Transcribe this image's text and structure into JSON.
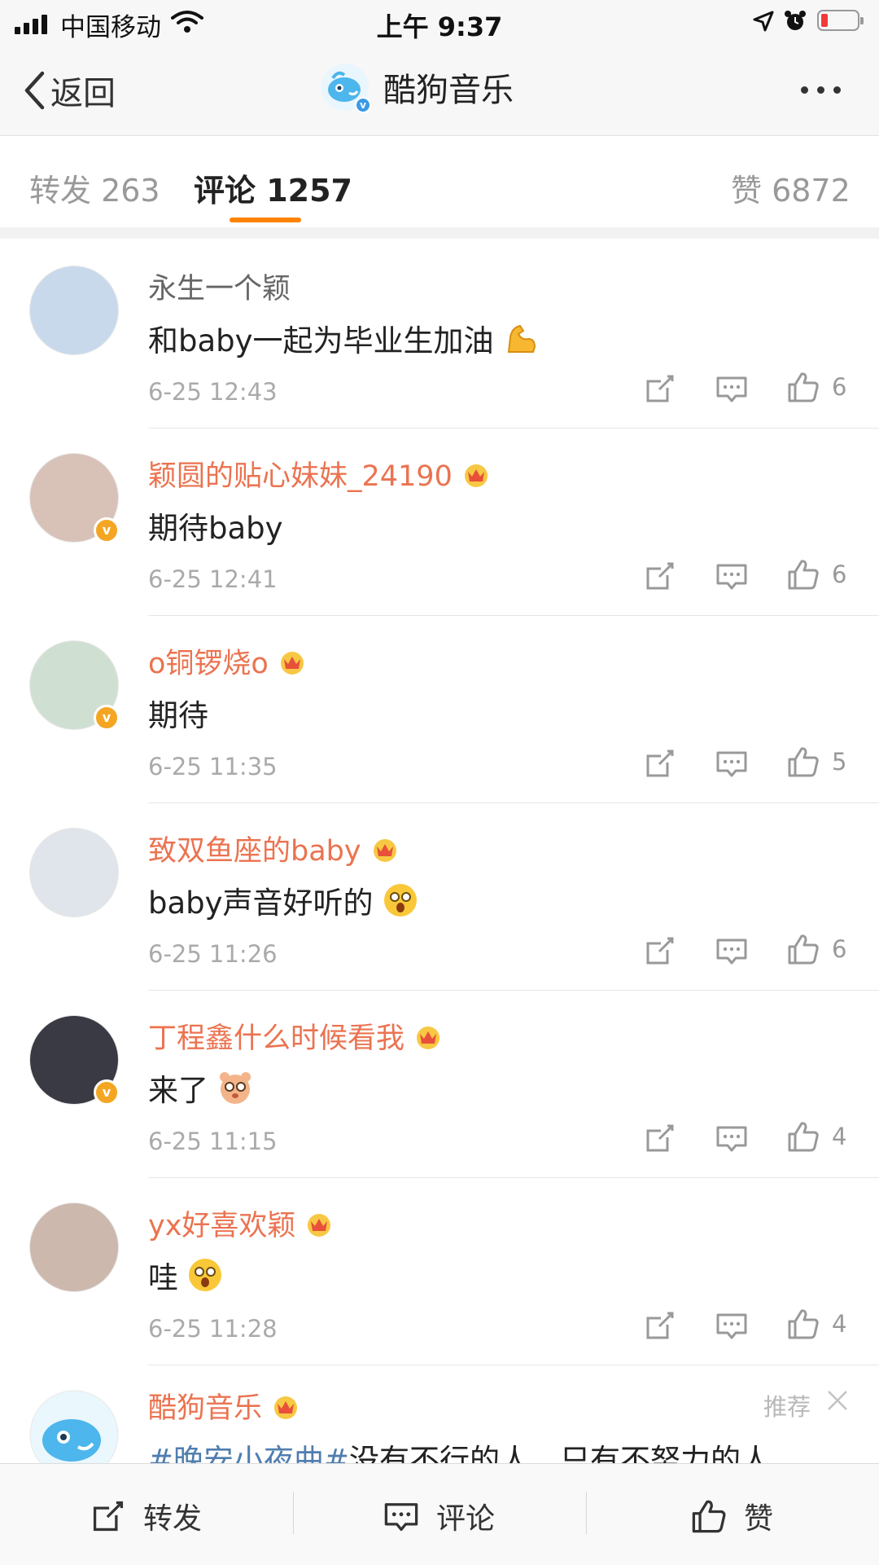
{
  "status_bar": {
    "carrier": "中国移动",
    "time": "上午 9:37",
    "battery_level_fraction": 0.15
  },
  "nav": {
    "back_label": "返回",
    "title": "酷狗音乐"
  },
  "tabs": [
    {
      "label": "转发 263"
    },
    {
      "label": "评论 1257",
      "active": true
    },
    {
      "label": "赞 6872"
    }
  ],
  "comments": [
    {
      "user": "永生一个颖",
      "vip": false,
      "verified": false,
      "text": "和baby一起为毕业生加油",
      "emoji": "flexed-biceps",
      "time": "6-25 12:43",
      "likes": "6",
      "avatar_color": "#c9d9ec"
    },
    {
      "user": "颖圆的贴心妹妹_24190",
      "vip": true,
      "verified": true,
      "text": "期待baby",
      "emoji": "",
      "time": "6-25 12:41",
      "likes": "6",
      "avatar_color": "#d8c2b8"
    },
    {
      "user": "o铜锣烧o",
      "vip": true,
      "verified": true,
      "text": "期待",
      "emoji": "",
      "time": "6-25 11:35",
      "likes": "5",
      "avatar_color": "#cfe0d2"
    },
    {
      "user": "致双鱼座的baby",
      "vip": true,
      "verified": false,
      "text": "baby声音好听的",
      "emoji": "surprised-face",
      "time": "6-25 11:26",
      "likes": "6",
      "avatar_color": "#dfe5ea"
    },
    {
      "user": "丁程鑫什么时候看我",
      "vip": true,
      "verified": true,
      "text": "来了",
      "emoji": "bear-face",
      "time": "6-25 11:15",
      "likes": "4",
      "avatar_color": "#3a3a44"
    },
    {
      "user": "yx好喜欢颖",
      "vip": true,
      "verified": false,
      "text": "哇",
      "emoji": "surprised-face",
      "time": "6-25 11:28",
      "likes": "4",
      "avatar_color": "#cdb8ae"
    }
  ],
  "partial_comment": {
    "user": "酷狗音乐",
    "tag": "推荐",
    "topic": "#晚安小夜曲#",
    "text": "没有不行的人，只有不努力的人。"
  },
  "bottom_bar": {
    "repost": "转发",
    "comment": "评论",
    "like": "赞"
  },
  "colors": {
    "accent": "#ff8200",
    "vip_name": "#eb7350",
    "topic": "#507daf"
  },
  "icons": [
    "back-chevron-icon",
    "more-dots-icon",
    "share-icon",
    "reply-icon",
    "like-icon",
    "crown-icon",
    "close-icon"
  ]
}
